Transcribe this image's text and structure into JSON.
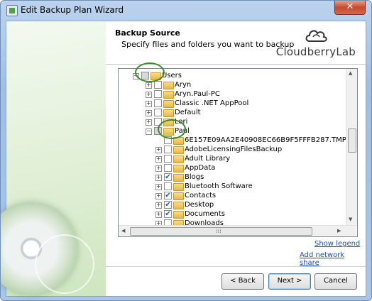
{
  "window": {
    "title": "Edit Backup Plan Wizard",
    "close_label": "✕"
  },
  "header": {
    "title": "Backup Source",
    "subtitle": "Specify files and folders you want to backup",
    "logo_text": "CloudberryLab"
  },
  "tree": {
    "root": {
      "label": "Users",
      "expander": "⊟",
      "check": "partial"
    },
    "users": [
      {
        "label": "Aryn",
        "expander": "⊞",
        "checked": false
      },
      {
        "label": "Aryn.Paul-PC",
        "expander": "⊞",
        "checked": false
      },
      {
        "label": "Classic .NET AppPool",
        "expander": "⊞",
        "checked": false
      },
      {
        "label": "Default",
        "expander": "⊞",
        "checked": false
      },
      {
        "label": "Lori",
        "expander": "⊞",
        "checked": false
      },
      {
        "label": "Paul",
        "expander": "⊟",
        "check": "partial"
      }
    ],
    "paul_children": [
      {
        "label": "6E157E09AA2E40908EC66B9F5FFFB287.TMP",
        "expander": "",
        "checked": false
      },
      {
        "label": "AdobeLicensingFilesBackup",
        "expander": "⊞",
        "checked": false
      },
      {
        "label": "Adult Library",
        "expander": "⊞",
        "checked": false
      },
      {
        "label": "AppData",
        "expander": "⊞",
        "checked": false
      },
      {
        "label": "Blogs",
        "expander": "⊞",
        "checked": true
      },
      {
        "label": "Bluetooth Software",
        "expander": "⊞",
        "checked": false
      },
      {
        "label": "Contacts",
        "expander": "⊞",
        "checked": true
      },
      {
        "label": "Desktop",
        "expander": "⊞",
        "checked": true
      },
      {
        "label": "Documents",
        "expander": "⊞",
        "checked": true
      },
      {
        "label": "Downloads",
        "expander": "⊞",
        "checked": false
      }
    ]
  },
  "links": {
    "show_legend": "Show legend",
    "add_network_share": "Add network share"
  },
  "buttons": {
    "back": "< Back",
    "next": "Next >",
    "cancel": "Cancel"
  },
  "colors": {
    "accent": "#1f4fb5",
    "annotation": "#3c8a2a",
    "check": "#1d56c9"
  },
  "icons": {
    "check": "✔"
  }
}
